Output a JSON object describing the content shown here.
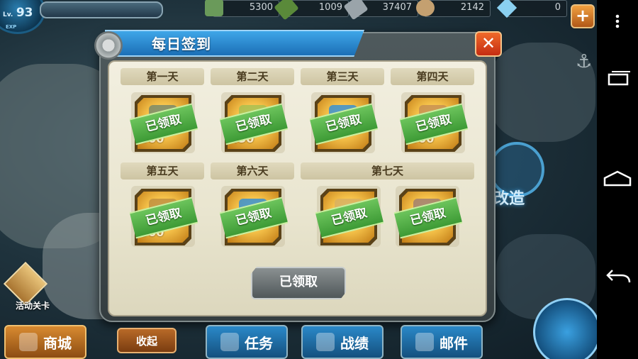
{
  "player": {
    "level_label": "Lv.",
    "level": "93",
    "exp_label": "EXP"
  },
  "resources": [
    {
      "icon": "fuel-icon",
      "value": "5300",
      "color": "#6a9a5a"
    },
    {
      "icon": "ammo-icon",
      "value": "1009",
      "color": "#5a8a3a"
    },
    {
      "icon": "steel-icon",
      "value": "37407",
      "color": "#9aa4aa"
    },
    {
      "icon": "bauxite-icon",
      "value": "2142",
      "color": "#c4a070"
    },
    {
      "icon": "gem-icon",
      "value": "0",
      "color": "#8ad0f0"
    }
  ],
  "plus_label": "+",
  "dialog": {
    "title": "每日签到",
    "close_label": "✕",
    "claimed_label": "已领取",
    "claim_button": "已领取",
    "days": [
      {
        "label": "第一天",
        "amount": "300",
        "item_color": "#7a8a6a"
      },
      {
        "label": "第二天",
        "amount": "450",
        "item_color": "#a8c050"
      },
      {
        "label": "第三天",
        "amount": "",
        "item_color": "#3a90d0"
      },
      {
        "label": "第四天",
        "amount": "300",
        "item_color": "#c89050"
      },
      {
        "label": "第五天",
        "amount": "300",
        "item_color": "#c09040"
      },
      {
        "label": "第六天",
        "amount": "2",
        "item_color": "#3a90d0"
      }
    ],
    "day7": {
      "label": "第七天",
      "items": [
        {
          "amount": "",
          "item_color": "#d8b060"
        },
        {
          "amount": "",
          "item_color": "#a08070"
        }
      ]
    }
  },
  "side": {
    "event_label": "活动关卡",
    "upgrade_label": "改造"
  },
  "bottom": {
    "shop": "商城",
    "collapse": "收起",
    "quests": "任务",
    "records": "战绩",
    "mail": "邮件"
  },
  "colors": {
    "accent": "#2a8ad0",
    "stamp": "#4aa83e",
    "frame": "#5a4218"
  }
}
